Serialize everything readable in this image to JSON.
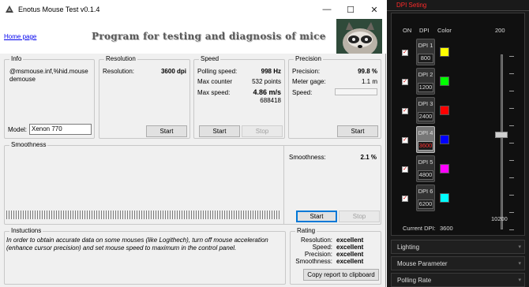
{
  "window": {
    "title": "Enotus Mouse Test v0.1.4"
  },
  "header": {
    "home_link": "Home page",
    "banner": "Program for testing and diagnosis of mice"
  },
  "info": {
    "title": "Info",
    "device": "@msmouse.inf,%hid.mousedemouse",
    "model_label": "Model:",
    "model_value": "Xenon 770"
  },
  "resolution": {
    "title": "Resolution",
    "label": "Resolution:",
    "value": "3600 dpi",
    "start": "Start"
  },
  "speed": {
    "title": "Speed",
    "polling_label": "Polling speed:",
    "polling_value": "998 Hz",
    "max_counter_label": "Max counter",
    "max_counter_value": "532 points",
    "max_speed_label": "Max  speed:",
    "max_speed_value": "4.86 m/s",
    "max_speed_sub": "688418",
    "start": "Start",
    "stop": "Stop"
  },
  "precision": {
    "title": "Precision",
    "precision_label": "Precision:",
    "precision_value": "99.8 %",
    "gage_label": "Meter gage:",
    "gage_value": "1.1 m",
    "speed_label": "Speed:",
    "start": "Start"
  },
  "smoothness": {
    "title": "Smoothness",
    "label": "Smoothness:",
    "value": "2.1 %",
    "start": "Start",
    "stop": "Stop"
  },
  "instructions": {
    "title": "Instuctions",
    "text": "In order to obtain accurate data on some mouses (like Logithech), turn off mouse acceleration (enhance cursor precision) and set mouse speed to maximum in the control panel."
  },
  "rating": {
    "title": "Rating",
    "rows": [
      {
        "label": "Resolution:",
        "value": "excellent"
      },
      {
        "label": "Speed:",
        "value": "excellent"
      },
      {
        "label": "Precision:",
        "value": "excellent"
      },
      {
        "label": "Smoothness:",
        "value": "excellent"
      }
    ],
    "copy": "Copy report to clipboard"
  },
  "dpi_panel": {
    "title": "DPI Seting",
    "col_on": "ON",
    "col_dpi": "DPI",
    "col_color": "Color",
    "slider_max": "200",
    "slider_min": "10200",
    "current_label": "Current DPI:",
    "current_value": "3600",
    "items": [
      {
        "name": "DPI 1",
        "value": "800",
        "color": "#ffff00",
        "selected": false
      },
      {
        "name": "DPI 2",
        "value": "1200",
        "color": "#00ff00",
        "selected": false
      },
      {
        "name": "DPI 3",
        "value": "2400",
        "color": "#ff0000",
        "selected": false
      },
      {
        "name": "DPI 4",
        "value": "3600",
        "color": "#0000ff",
        "selected": true
      },
      {
        "name": "DPI 5",
        "value": "4800",
        "color": "#ff00ff",
        "selected": false
      },
      {
        "name": "DPI 6",
        "value": "6200",
        "color": "#00ffff",
        "selected": false
      }
    ],
    "slider_position_fraction": 0.46,
    "sections": [
      "Lighting",
      "Mouse Parameter",
      "Polling Rate"
    ]
  }
}
